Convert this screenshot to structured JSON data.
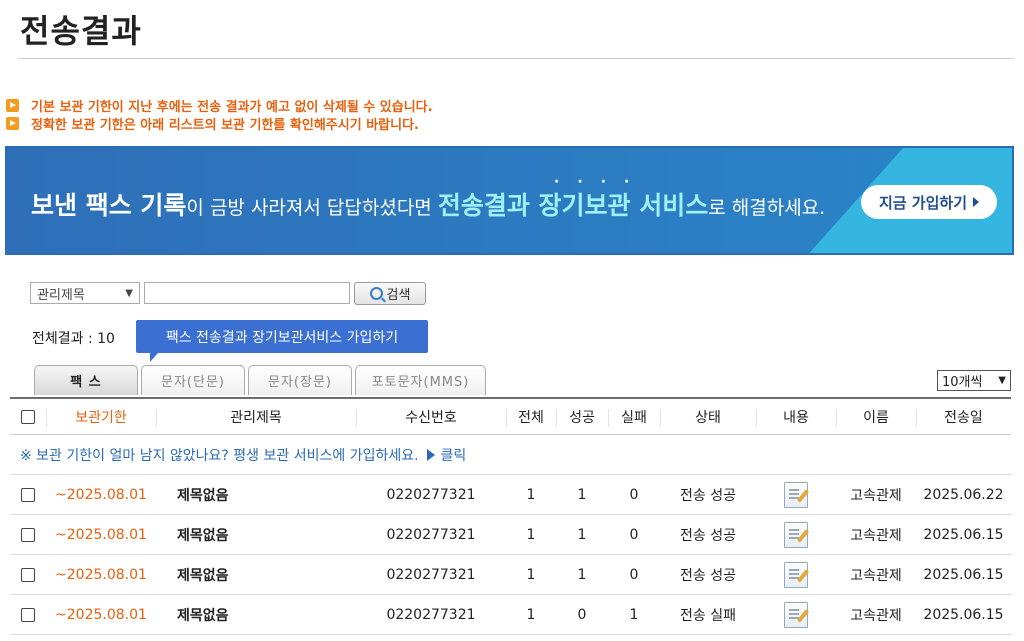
{
  "page_title": "전송결과",
  "notices": [
    "기본 보관 기한이 지난 후에는 전송 결과가 예고 없이 삭제될 수 있습니다.",
    "정확한 보관 기한은 아래 리스트의 보관 기한를 확인해주시기 바랍니다."
  ],
  "banner": {
    "part1": "보낸 팩스 기록",
    "part2": "이 금방 사라져서 답답하셨다면 ",
    "part3": "전송결과 장기보관 서비스",
    "part4": "로 해결하세요.",
    "dots": "····",
    "button": "지금 가입하기"
  },
  "search": {
    "select_value": "관리제목",
    "input_value": "",
    "button_label": "검색"
  },
  "total_label": "전체결과 : 10",
  "tooltip": "팩스 전송결과 장기보관서비스 가입하기",
  "tabs": [
    "팩 스",
    "문자(단문)",
    "문자(장문)",
    "포토문자(MMS)"
  ],
  "per_page": "10개씩",
  "table": {
    "headers": {
      "expiry": "보관기한",
      "title": "관리제목",
      "number": "수신번호",
      "total": "전체",
      "success": "성공",
      "fail": "실패",
      "status": "상태",
      "content": "내용",
      "name": "이름",
      "date": "전송일"
    },
    "promo": {
      "text": "※ 보관 기한이 얼마 남지 않았나요? 평생 보관 서비스에 가입하세요.",
      "link": "클릭"
    },
    "rows": [
      {
        "expiry": "~2025.08.01",
        "title": "제목없음",
        "number": "0220277321",
        "total": "1",
        "success": "1",
        "fail": "0",
        "status": "전송 성공",
        "name": "고속관제",
        "date": "2025.06.22"
      },
      {
        "expiry": "~2025.08.01",
        "title": "제목없음",
        "number": "0220277321",
        "total": "1",
        "success": "1",
        "fail": "0",
        "status": "전송 성공",
        "name": "고속관제",
        "date": "2025.06.15"
      },
      {
        "expiry": "~2025.08.01",
        "title": "제목없음",
        "number": "0220277321",
        "total": "1",
        "success": "1",
        "fail": "0",
        "status": "전송 성공",
        "name": "고속관제",
        "date": "2025.06.15"
      },
      {
        "expiry": "~2025.08.01",
        "title": "제목없음",
        "number": "0220277321",
        "total": "1",
        "success": "0",
        "fail": "1",
        "status": "전송 실패",
        "name": "고속관제",
        "date": "2025.06.15"
      }
    ]
  },
  "colors": {
    "accent_orange": "#e8610f",
    "banner_blue": "#2e6fb8",
    "banner_cyan": "#35b6e0",
    "link_blue": "#2b6bb5",
    "tooltip_blue": "#3b6fd2"
  }
}
